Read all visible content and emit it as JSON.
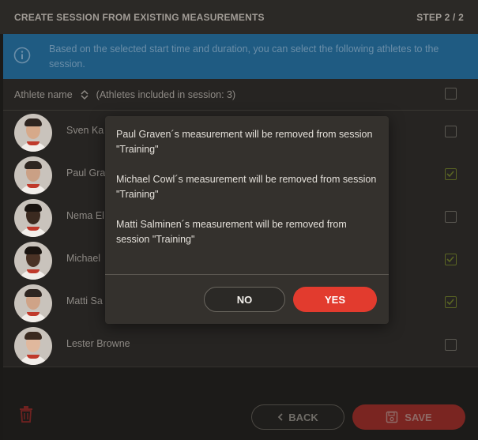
{
  "header": {
    "title": "CREATE SESSION FROM EXISTING MEASUREMENTS",
    "step": "STEP 2 / 2"
  },
  "info": {
    "text": "Based on the selected start time and duration, you can select the following athletes to the session.",
    "icon": "info-circle-icon"
  },
  "list": {
    "column_label": "Athlete name",
    "count_text": "(Athletes included in session: 3)",
    "select_all_checked": false,
    "rows": [
      {
        "name": "Sven Ka",
        "checked": false
      },
      {
        "name": "Paul Gra",
        "checked": true
      },
      {
        "name": "Nema El",
        "checked": false
      },
      {
        "name": "Michael",
        "checked": true
      },
      {
        "name": "Matti Sa",
        "checked": true
      },
      {
        "name": "Lester Browne",
        "checked": false
      }
    ]
  },
  "modal": {
    "messages": [
      "Paul Graven´s measurement will be removed from session \"Training\"",
      "Michael Cowl´s measurement will be removed from session \"Training\"",
      "Matti Salminen´s measurement will be removed from session \"Training\""
    ],
    "no_label": "NO",
    "yes_label": "YES"
  },
  "footer": {
    "back_label": "BACK",
    "save_label": "SAVE"
  },
  "colors": {
    "accent_red": "#e23b2e",
    "info_blue": "#1f5b82",
    "check_green": "#5a6523"
  }
}
